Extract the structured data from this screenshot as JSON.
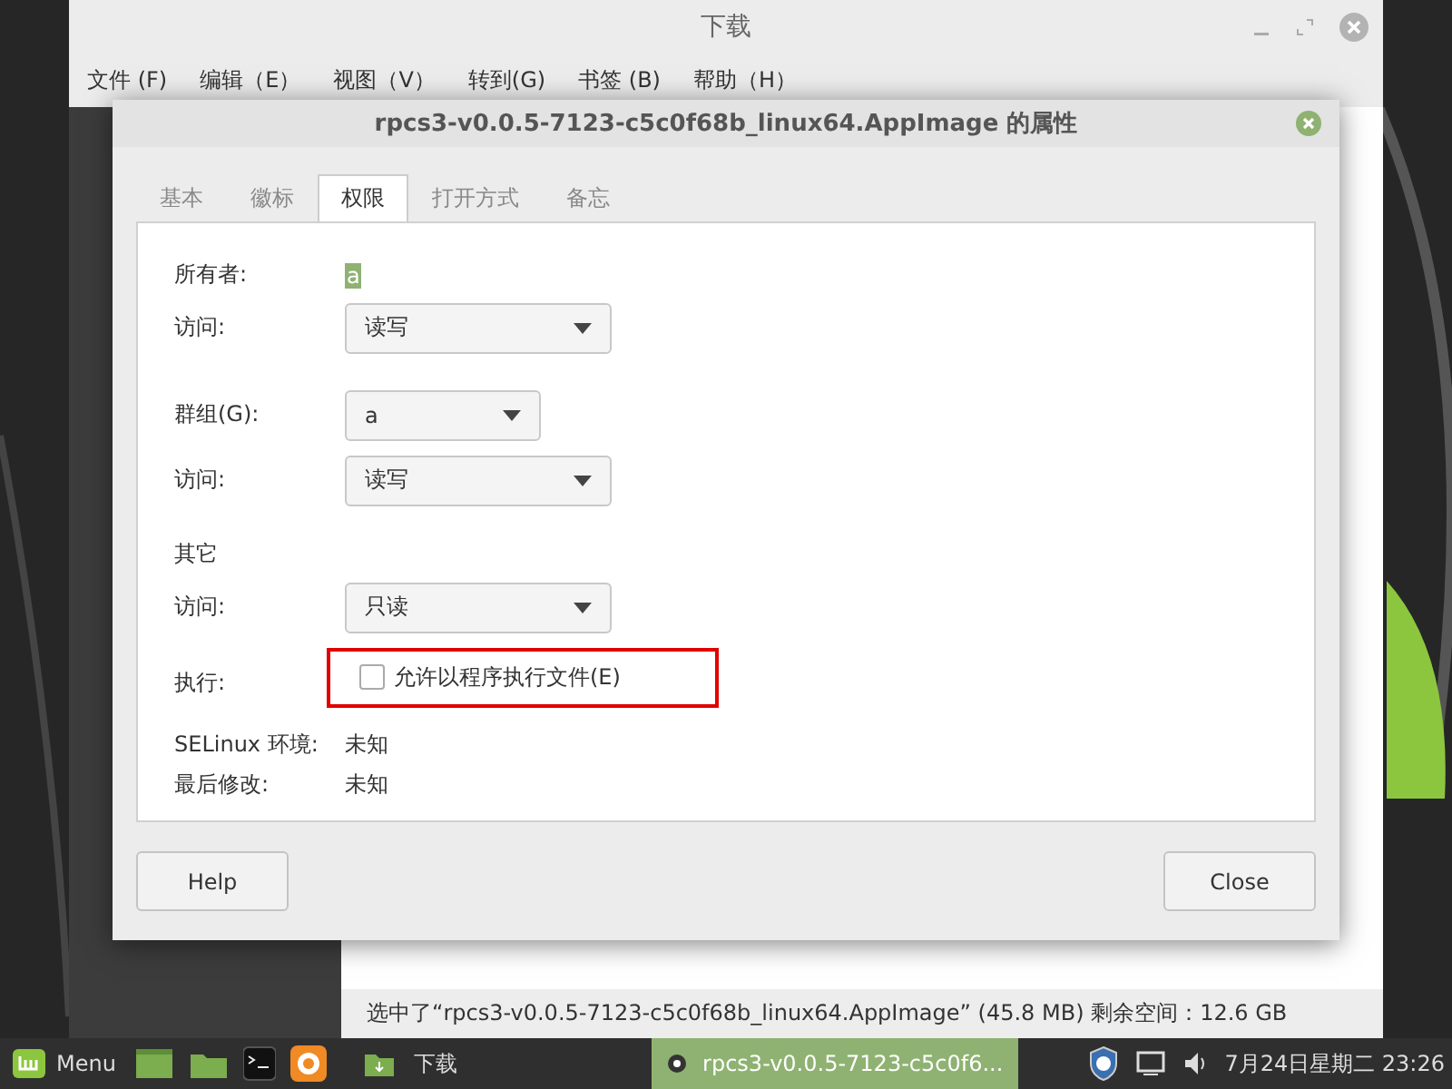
{
  "back_window": {
    "title": "下载",
    "menu": [
      "文件 (F)",
      "编辑（E）",
      "视图（V）",
      "转到(G)",
      "书签 (B)",
      "帮助（H）"
    ],
    "status_bar": "选中了“rpcs3-v0.0.5-7123-c5c0f68b_linux64.AppImage” (45.8 MB) 剩余空间：12.6 GB"
  },
  "dialog": {
    "title": "rpcs3-v0.0.5-7123-c5c0f68b_linux64.AppImage 的属性",
    "tabs": [
      {
        "label": "基本",
        "selected": false
      },
      {
        "label": "徽标",
        "selected": false
      },
      {
        "label": "权限",
        "selected": true
      },
      {
        "label": "打开方式",
        "selected": false
      },
      {
        "label": "备忘",
        "selected": false
      }
    ],
    "rows": [
      {
        "kind": "value",
        "label": "所有者:",
        "value": "a",
        "highlighted": true
      },
      {
        "kind": "dropdown",
        "label": "访问:",
        "value": "读写",
        "wide": true
      },
      {
        "kind": "gap"
      },
      {
        "kind": "dropdown",
        "label": "群组(G):",
        "value": "a",
        "wide": false
      },
      {
        "kind": "dropdown",
        "label": "访问:",
        "value": "读写",
        "wide": true
      },
      {
        "kind": "gap"
      },
      {
        "kind": "heading",
        "label": "其它"
      },
      {
        "kind": "dropdown",
        "label": "访问:",
        "value": "只读",
        "wide": true
      },
      {
        "kind": "checkbox",
        "label": "执行:",
        "value": "允许以程序执行文件(E)",
        "checked": false,
        "highlighted": true
      },
      {
        "kind": "value",
        "label": "SELinux 环境:",
        "value": "未知",
        "highlighted": false
      },
      {
        "kind": "value",
        "label": "最后修改:",
        "value": "未知",
        "highlighted": false
      }
    ],
    "buttons": [
      "Help",
      "Close"
    ]
  },
  "taskbar": {
    "menu_label": "Menu",
    "launcher_label": "下载",
    "window_button": "rpcs3-v0.0.5-7123-c5c0f6...",
    "clock": "7月24日星期二 23:26"
  }
}
